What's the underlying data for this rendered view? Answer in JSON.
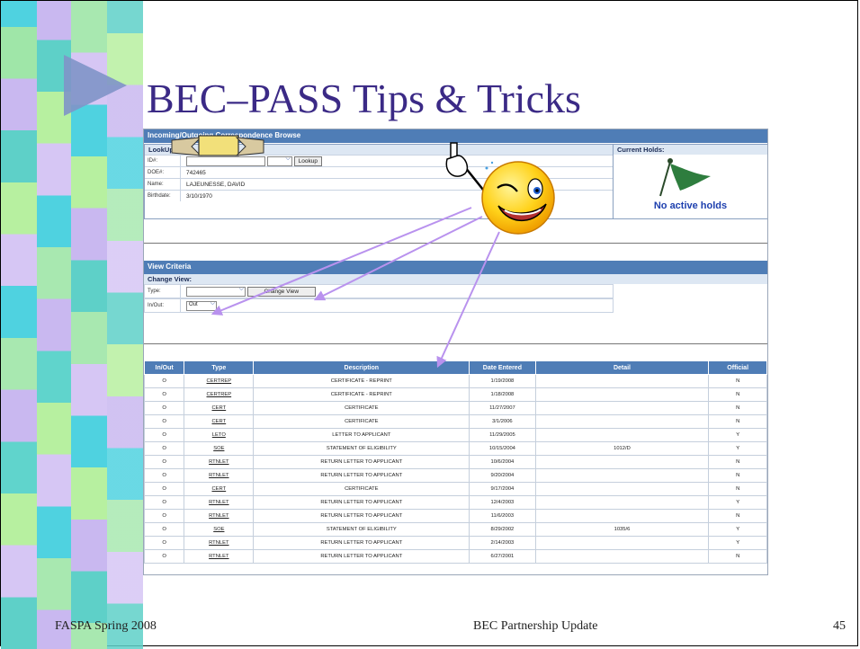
{
  "slide": {
    "title": "BEC–PASS Tips & Tricks",
    "footer_left": "FASPA Spring 2008",
    "footer_center": "BEC Partnership Update",
    "page_number": "45",
    "pointer_icon": "winking-smiley-pointing-icon",
    "accent_color": "#3b2a86"
  },
  "screen": {
    "title": "Incoming/Outgoing Correspondence Browse",
    "lookup": {
      "header": "LookUp:",
      "id_label": "ID#:",
      "lookup_button": "Lookup",
      "doe_label": "DOE#:",
      "doe_value": "742465",
      "name_label": "Name:",
      "name_value": "LAJEUNESSE, DAVID",
      "birth_label": "Birthdate:",
      "birth_value": "3/10/1970"
    },
    "holds": {
      "header": "Current Holds:",
      "text": "No active holds",
      "icon": "green-flag-icon"
    },
    "view": {
      "header": "View Criteria",
      "sub": "Change View:",
      "type_label": "Type:",
      "change_button": "Change View",
      "inout_label": "In/Out:",
      "inout_value": "Out"
    },
    "table": {
      "headers": [
        "In/Out",
        "Type",
        "Description",
        "Date Entered",
        "Detail",
        "Official"
      ],
      "rows": [
        [
          "O",
          "CERTREP",
          "CERTIFICATE - REPRINT",
          "1/19/2008",
          "",
          "N"
        ],
        [
          "O",
          "CERTREP",
          "CERTIFICATE - REPRINT",
          "1/18/2008",
          "",
          "N"
        ],
        [
          "O",
          "CERT",
          "CERTIFICATE",
          "11/27/2007",
          "",
          "N"
        ],
        [
          "O",
          "CERT",
          "CERTIFICATE",
          "3/1/2006",
          "",
          "N"
        ],
        [
          "O",
          "LETO",
          "LETTER TO APPLICANT",
          "11/29/2005",
          "",
          "Y"
        ],
        [
          "O",
          "SOE",
          "STATEMENT OF ELIGIBILITY",
          "10/15/2004",
          "1012/D",
          "Y"
        ],
        [
          "O",
          "RTNLET",
          "RETURN LETTER TO APPLICANT",
          "10/6/2004",
          "",
          "N"
        ],
        [
          "O",
          "RTNLET",
          "RETURN LETTER TO APPLICANT",
          "9/20/2004",
          "",
          "N"
        ],
        [
          "O",
          "CERT",
          "CERTIFICATE",
          "9/17/2004",
          "",
          "N"
        ],
        [
          "O",
          "RTNLET",
          "RETURN LETTER TO APPLICANT",
          "12/4/2003",
          "",
          "Y"
        ],
        [
          "O",
          "RTNLET",
          "RETURN LETTER TO APPLICANT",
          "11/6/2003",
          "",
          "N"
        ],
        [
          "O",
          "SOE",
          "STATEMENT OF ELIGIBILITY",
          "8/29/2002",
          "1035/6",
          "Y"
        ],
        [
          "O",
          "RTNLET",
          "RETURN LETTER TO APPLICANT",
          "2/14/2003",
          "",
          "Y"
        ],
        [
          "O",
          "RTNLET",
          "RETURN LETTER TO APPLICANT",
          "6/27/2001",
          "",
          "N"
        ]
      ]
    }
  }
}
